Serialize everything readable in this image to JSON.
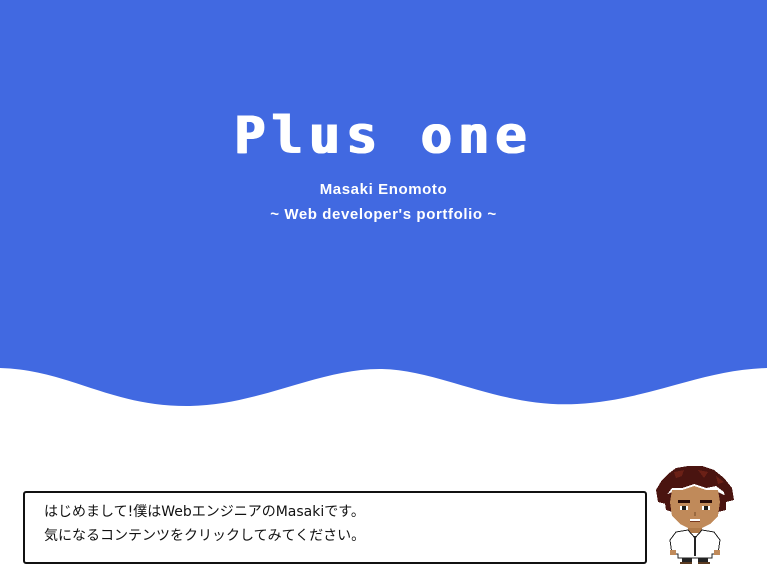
{
  "hero": {
    "title": "Plus one",
    "author": "Masaki Enomoto",
    "tagline": "~ Web developer's portfolio ~",
    "background_color": "#4169e1"
  },
  "dialog": {
    "line1": "はじめまして!僕はWebエンジニアのMasakiです。",
    "line2": "気になるコンテンツをクリックしてみてください。"
  },
  "avatar": {
    "icon": "pixel-character-icon"
  }
}
